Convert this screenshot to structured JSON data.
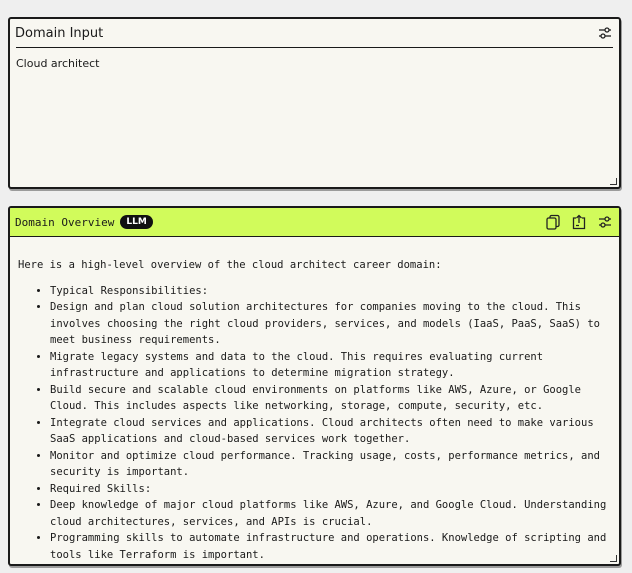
{
  "input_panel": {
    "title": "Domain Input",
    "value": "Cloud architect"
  },
  "overview_panel": {
    "title": "Domain Overview",
    "badge": "LLM",
    "intro": "Here is a high-level overview of the cloud architect career domain:",
    "items": [
      "Typical Responsibilities:",
      "Design and plan cloud solution architectures for companies moving to the cloud. This involves choosing the right cloud providers, services, and models (IaaS, PaaS, SaaS) to meet business requirements.",
      "Migrate legacy systems and data to the cloud. This requires evaluating current infrastructure and applications to determine migration strategy.",
      "Build secure and scalable cloud environments on platforms like AWS, Azure, or Google Cloud. This includes aspects like networking, storage, compute, security, etc.",
      "Integrate cloud services and applications. Cloud architects often need to make various SaaS applications and cloud-based services work together.",
      "Monitor and optimize cloud performance. Tracking usage, costs, performance metrics, and security is important.",
      "Required Skills:",
      "Deep knowledge of major cloud platforms like AWS, Azure, and Google Cloud. Understanding cloud architectures, services, and APIs is crucial.",
      "Programming skills to automate infrastructure and operations. Knowledge of scripting and tools like Terraform is important."
    ]
  },
  "colors": {
    "accent": "#d1fb5b",
    "panel_bg": "#f8f7f1",
    "border": "#1a1a1a"
  },
  "icons": [
    "settings-sliders-icon",
    "copy-icon",
    "export-icon"
  ]
}
